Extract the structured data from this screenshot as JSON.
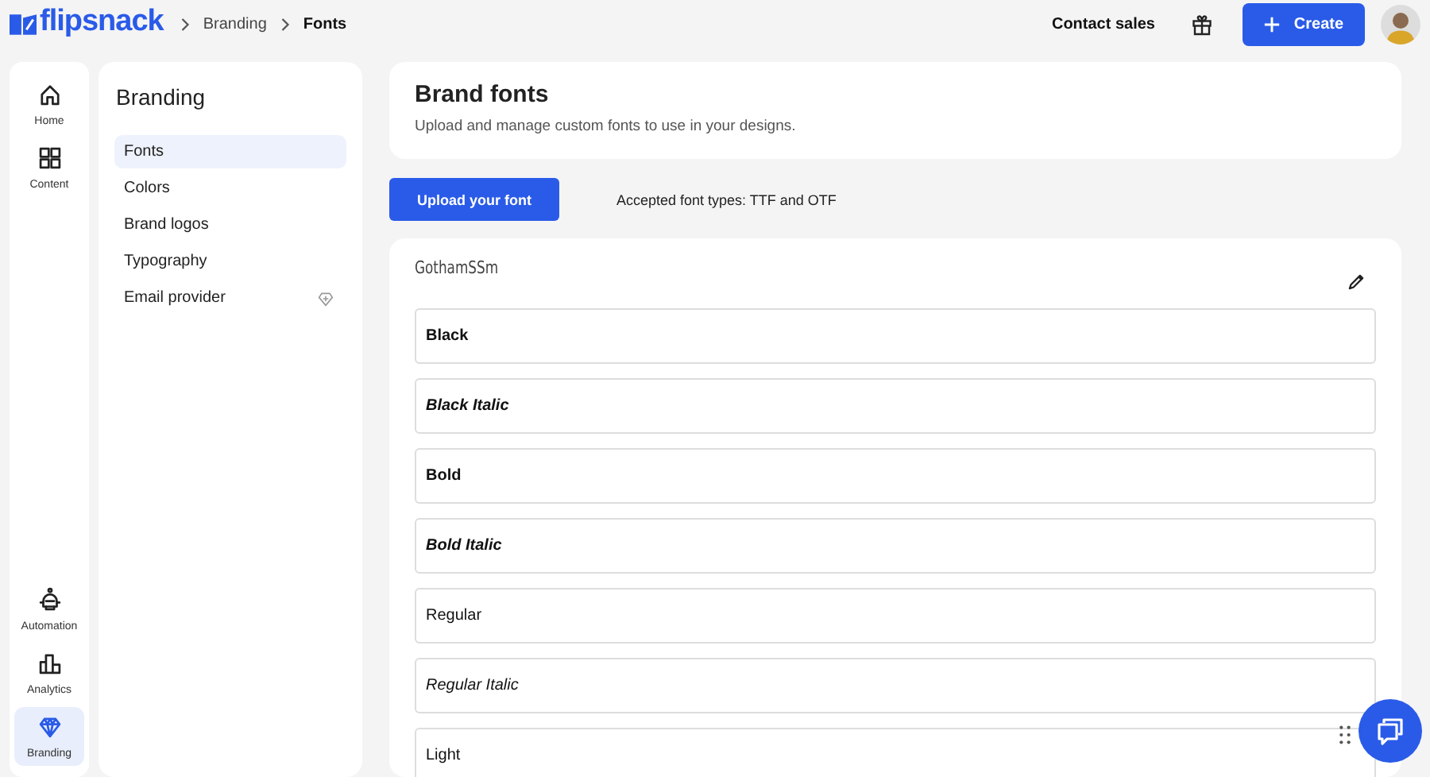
{
  "logo": "flipsnack",
  "breadcrumb": [
    "Branding",
    "Fonts"
  ],
  "header": {
    "contact": "Contact sales",
    "create": "Create"
  },
  "rail": [
    {
      "label": "Home",
      "selected": false
    },
    {
      "label": "Content",
      "selected": false
    },
    {
      "label": "Automation",
      "selected": false
    },
    {
      "label": "Analytics",
      "selected": false
    },
    {
      "label": "Branding",
      "selected": true
    }
  ],
  "panel": {
    "title": "Branding",
    "items": [
      {
        "label": "Fonts",
        "selected": true,
        "premium": false
      },
      {
        "label": "Colors",
        "selected": false,
        "premium": false
      },
      {
        "label": "Brand logos",
        "selected": false,
        "premium": false
      },
      {
        "label": "Typography",
        "selected": false,
        "premium": false
      },
      {
        "label": "Email provider",
        "selected": false,
        "premium": true
      }
    ]
  },
  "intro": {
    "title": "Brand fonts",
    "text": "Upload and manage custom fonts to use in your designs."
  },
  "upload": {
    "button": "Upload your font",
    "note": "Accepted font types: TTF and OTF"
  },
  "family": {
    "name": "GothamSSm",
    "styles": [
      {
        "label": "Black",
        "kind": "black",
        "italic": false
      },
      {
        "label": "Black Italic",
        "kind": "black",
        "italic": true
      },
      {
        "label": "Bold",
        "kind": "bold",
        "italic": false
      },
      {
        "label": "Bold Italic",
        "kind": "bold",
        "italic": true
      },
      {
        "label": "Regular",
        "kind": "regular",
        "italic": false
      },
      {
        "label": "Regular Italic",
        "kind": "regular",
        "italic": true
      },
      {
        "label": "Light",
        "kind": "light",
        "italic": false
      }
    ]
  }
}
